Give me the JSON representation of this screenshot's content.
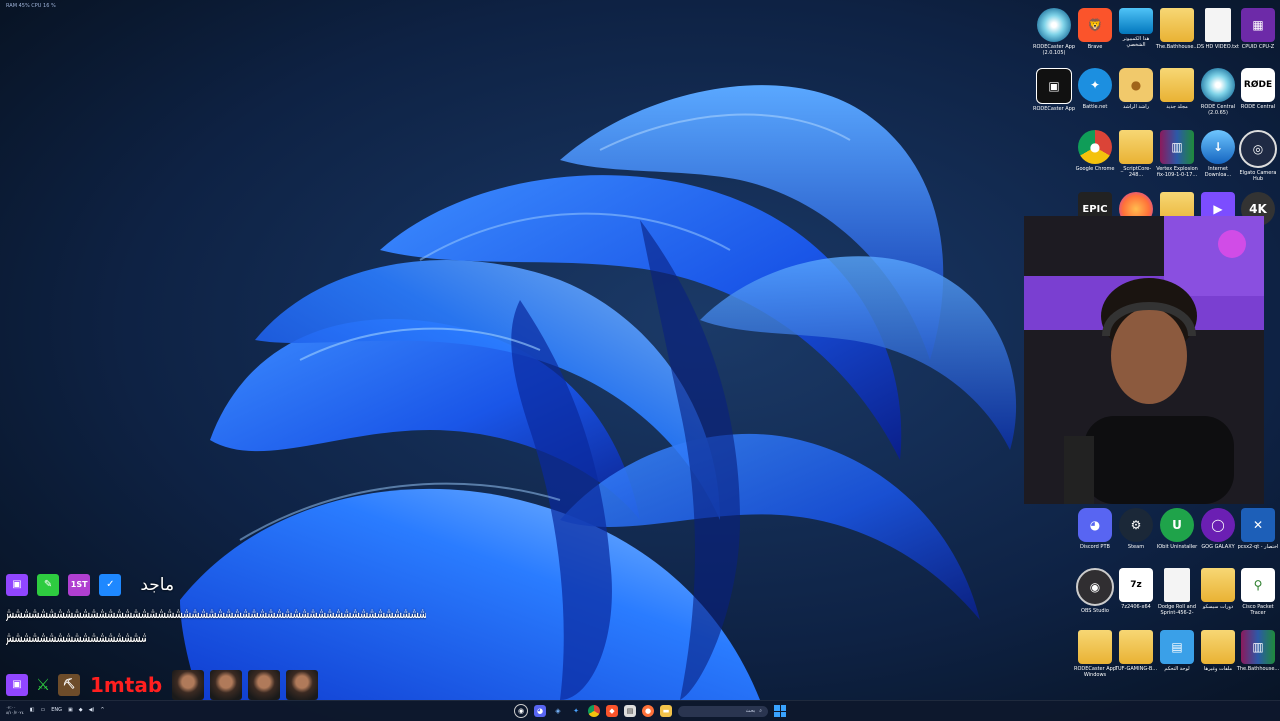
{
  "system": {
    "perf_overlay": "RAM 45%   CPU 16 %"
  },
  "desktop_icons": [
    {
      "name": "rodecaster-app-disc",
      "label": "RODECaster App (2.0.105)",
      "icon": "disc"
    },
    {
      "name": "brave",
      "label": "Brave",
      "icon": "brave"
    },
    {
      "name": "this-pc",
      "label": "هذا الكمبيوتر الشخصي",
      "icon": "monitor"
    },
    {
      "name": "the-bathhouse-folder",
      "label": "The.Bathhouse...",
      "icon": "folder"
    },
    {
      "name": "ds-hd-video",
      "label": "DS HD VIDEO.txt",
      "icon": "file"
    },
    {
      "name": "cpuid",
      "label": "CPUID CPU-Z",
      "icon": "cpuz"
    },
    {
      "name": "rodecaster-app",
      "label": "RODECaster App",
      "icon": "rodeapp"
    },
    {
      "name": "battlenet",
      "label": "Battle.net",
      "icon": "battle"
    },
    {
      "name": "user-folder",
      "label": "راشد الراشد",
      "icon": "user"
    },
    {
      "name": "new-folder",
      "label": "مجلد جديد",
      "icon": "folder"
    },
    {
      "name": "rode-central-disc",
      "label": "RODE Central (2.0.65)",
      "icon": "disc"
    },
    {
      "name": "rode-central",
      "label": "RODE Central",
      "icon": "rode"
    },
    {
      "name": "google-chrome",
      "label": "Google Chrome",
      "icon": "chrome"
    },
    {
      "name": "scriptcore",
      "label": "_ScriptCore-248...",
      "icon": "folder"
    },
    {
      "name": "vertex-explosion",
      "label": "Vertex Explosion fix-109-1-0-17...",
      "icon": "rar"
    },
    {
      "name": "internet-download",
      "label": "Internet Downloa...",
      "icon": "idm"
    },
    {
      "name": "elgato-camera-hub",
      "label": "Elgato Camera Hub",
      "icon": "elgato"
    },
    {
      "name": "epic-games",
      "label": "",
      "icon": "epic"
    },
    {
      "name": "firefox",
      "label": "",
      "icon": "firefox"
    },
    {
      "name": "folder-row4",
      "label": "",
      "icon": "folder"
    },
    {
      "name": "play-app",
      "label": "",
      "icon": "play"
    },
    {
      "name": "video-4k",
      "label": "",
      "icon": "k4"
    },
    {
      "name": "discord",
      "label": "Discord PTB",
      "icon": "discord"
    },
    {
      "name": "steam",
      "label": "Steam",
      "icon": "steam"
    },
    {
      "name": "iobit-uninstaller",
      "label": "IObit Uninstaller",
      "icon": "iobit"
    },
    {
      "name": "gog-galaxy",
      "label": "GOG GALAXY",
      "icon": "gog"
    },
    {
      "name": "pcsx2",
      "label": "pcsx2-qt - اختصار",
      "icon": "pcsx"
    },
    {
      "name": "obs-studio",
      "label": "OBS Studio",
      "icon": "obs"
    },
    {
      "name": "7zip",
      "label": "7z2406-x64",
      "icon": "sevenzip"
    },
    {
      "name": "dodge-roll",
      "label": "Dodge Roll and Sprint-456-2-38...",
      "icon": "file"
    },
    {
      "name": "courses-folder",
      "label": "دورات سيسكو",
      "icon": "folder"
    },
    {
      "name": "cisco-packet-tracer",
      "label": "Cisco Packet Tracer",
      "icon": "cisco"
    },
    {
      "name": "rodecaster-windows",
      "label": "RODECaster App Windows v2.0.105",
      "icon": "folder"
    },
    {
      "name": "tuf-gaming",
      "label": "TUF-GAMING-B...",
      "icon": "folder"
    },
    {
      "name": "control-panel",
      "label": "لوحة التحكم",
      "icon": "ctrl"
    },
    {
      "name": "files-folder",
      "label": "ملفات وغيرها",
      "icon": "folder"
    },
    {
      "name": "the-bathhouse-rar",
      "label": "The.Bathhouse...",
      "icon": "rar"
    }
  ],
  "icon_glyphs": {
    "brave": "🦁",
    "cpuz": "▦",
    "rodeapp": "▣",
    "battle": "✦",
    "user": "●",
    "rode": "RØDE",
    "idm": "↓",
    "elgato": "◎",
    "epic": "EPIC",
    "play": "▶",
    "k4": "4K",
    "discord": "◕",
    "steam": "⚙",
    "iobit": "U",
    "gog": "◯",
    "pcsx": "✕",
    "obs": "◉",
    "sevenzip": "7z",
    "cisco": "⚲",
    "ctrl": "▤",
    "chrome": "●",
    "rar": "▥",
    "monitor": "",
    "disc": "",
    "folder": "",
    "file": ""
  },
  "chat": {
    "user1": "ماجد",
    "line1": "ششششششششششششششششششششششششششششششششششششششششششششششششششششش",
    "line2": "ششششششششششششششششششش",
    "badges1": [
      "twitch",
      "green",
      "1st",
      "blue"
    ],
    "user2": "1mtab"
  },
  "taskbar": {
    "lang": "ENG",
    "clock_time": "٠٢:٠٠",
    "clock_date": "٨/١٠/٢٠٢٤",
    "search_placeholder": "بحث"
  },
  "colors": {
    "accent": "#39a3ff",
    "chat_user2": "#ff1f1f",
    "twitch": "#9146ff"
  }
}
